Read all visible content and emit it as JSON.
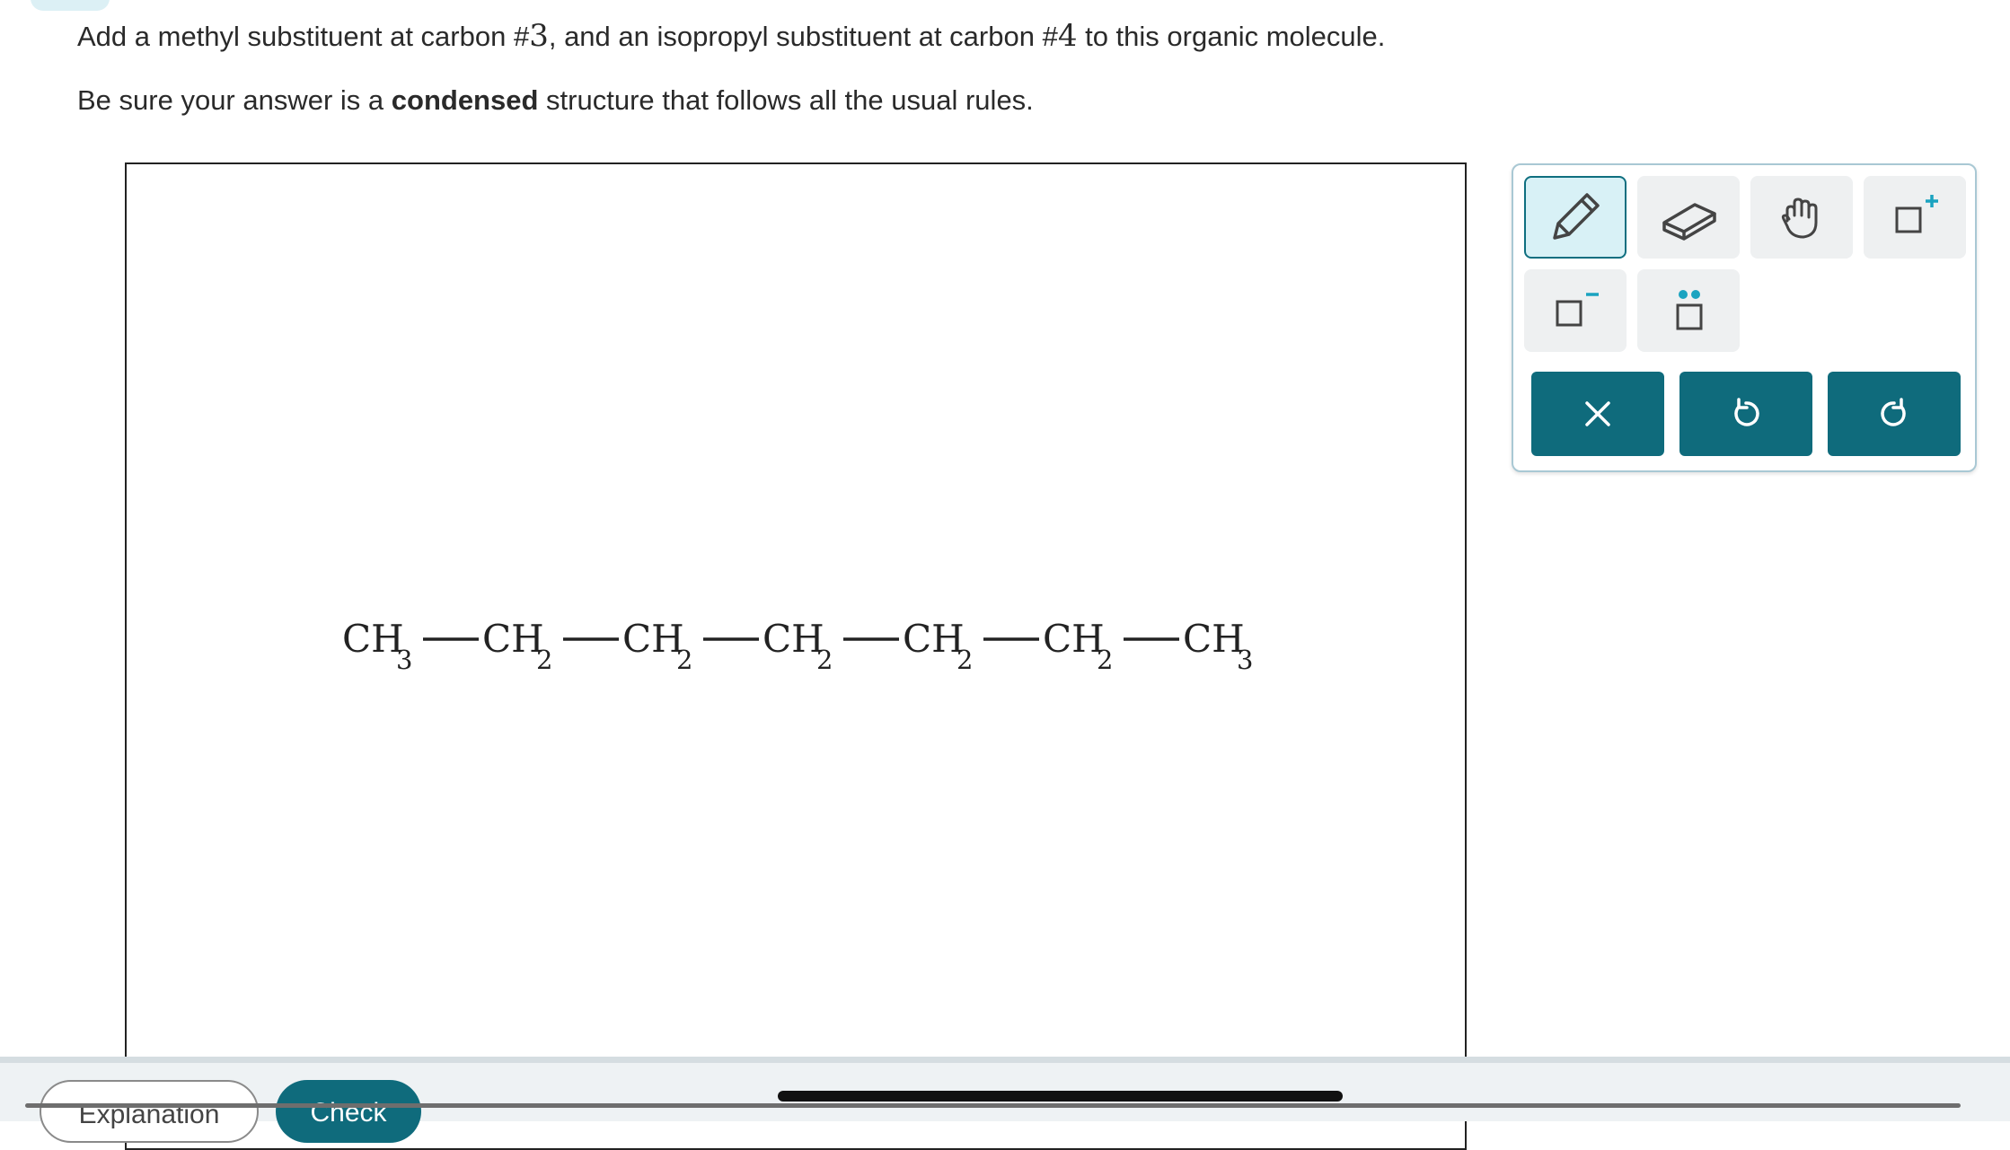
{
  "prompt": {
    "line1": {
      "part1": "Add a methyl substituent at carbon #",
      "num1": "3",
      "part2": ", and an isopropyl substituent at carbon #",
      "num2": "4",
      "part3": " to this organic molecule."
    },
    "line2": {
      "before": "Be sure your answer is a ",
      "bold": "condensed",
      "after": " structure that follows all the usual rules."
    }
  },
  "molecule": {
    "groups": [
      {
        "main": "CH",
        "sub": "3"
      },
      {
        "main": "CH",
        "sub": "2"
      },
      {
        "main": "CH",
        "sub": "2"
      },
      {
        "main": "CH",
        "sub": "2"
      },
      {
        "main": "CH",
        "sub": "2"
      },
      {
        "main": "CH",
        "sub": "2"
      },
      {
        "main": "CH",
        "sub": "3"
      }
    ]
  },
  "toolbar": {
    "tools": [
      "pencil-icon",
      "eraser-icon",
      "hand-icon",
      "add-charge-icon",
      "remove-charge-icon",
      "lone-pair-icon"
    ],
    "actions": [
      "clear-icon",
      "undo-icon",
      "redo-icon"
    ],
    "accent_color": "#0f6b7c",
    "highlight_color": "#1aa3c0"
  },
  "footer": {
    "explanation_label": "Explanation",
    "check_label": "Check"
  }
}
